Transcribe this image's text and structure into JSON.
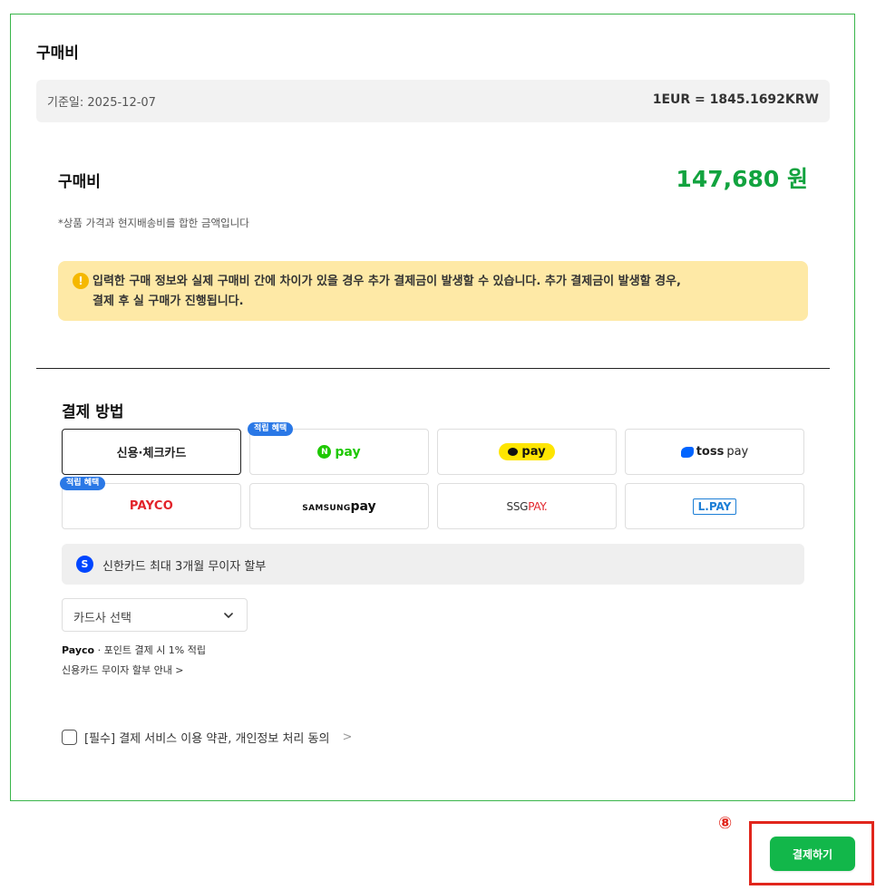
{
  "section": {
    "title": "구매비"
  },
  "rate": {
    "date_label": "기준일: 2025-12-07",
    "value": "1EUR = 1845.1692KRW"
  },
  "price": {
    "label": "구매비",
    "amount": "147,680 원",
    "note": "*상품 가격과 현지배송비를 합한 금액입니다",
    "accent_color": "#12a33f"
  },
  "notice": {
    "icon": "exclamation-icon",
    "line1": "입력한 구매 정보와 실제 구매비 간에 차이가 있을 경우 추가 결제금이 발생할 수 있습니다. 추가 결제금이 발생할 경우,",
    "line2": "결제 후 실 구매가 진행됩니다."
  },
  "payment": {
    "title": "결제 방법",
    "badge_label": "적립 혜택",
    "methods": {
      "card": "신용·체크카드",
      "npay": "pay",
      "npay_n": "N",
      "kakaopay": "pay",
      "toss": "toss",
      "toss_pay": "pay",
      "payco": "PAYCO",
      "samsung_prefix": "SAMSUNG",
      "samsung_pay": "pay",
      "ssg": "SSG",
      "ssg_pay": "PAY.",
      "lpay": "L.PAY"
    }
  },
  "promo": {
    "icon_letter": "S",
    "text": "신한카드 최대 3개월 무이자 할부"
  },
  "card_select": {
    "placeholder": "카드사 선택"
  },
  "payco_point": {
    "brand": "Payco",
    "text": " · 포인트 결제 시 1% 적립"
  },
  "installment_link": "신용카드 무이자 할부 안내 >",
  "agreement": {
    "text": "[필수] 결제 서비스 이용 약관, 개인정보 처리 동의",
    "arrow": ">"
  },
  "annotation": {
    "number": "⑧"
  },
  "submit": {
    "label": "결제하기",
    "color": "#12b74a"
  }
}
